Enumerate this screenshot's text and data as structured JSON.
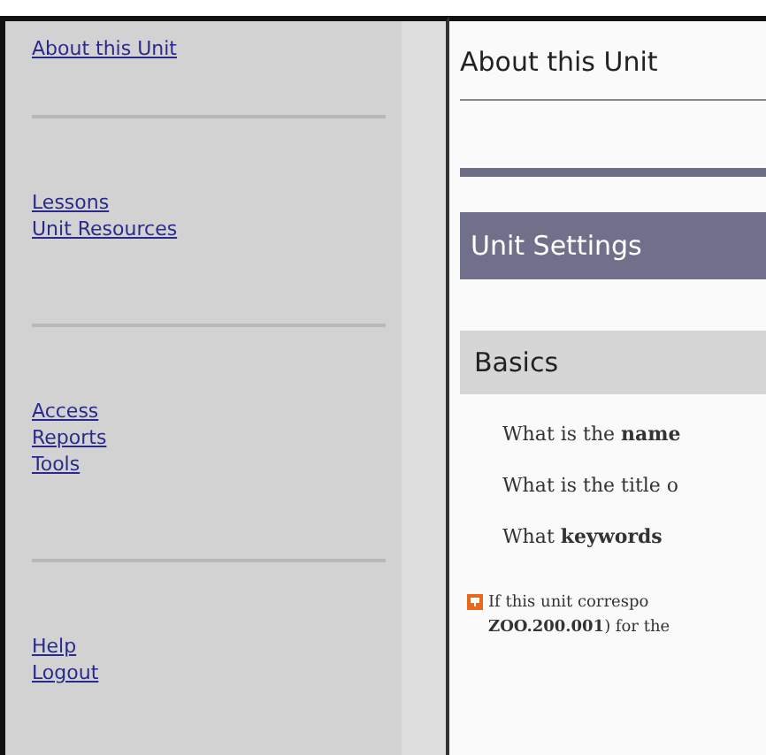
{
  "sidebar": {
    "sections": [
      {
        "links": [
          "About this Unit"
        ]
      },
      {
        "links": [
          "Lessons",
          "Unit Resources"
        ]
      },
      {
        "links": [
          "Access",
          "Reports",
          "Tools"
        ]
      },
      {
        "links": [
          "Help",
          "Logout"
        ]
      }
    ]
  },
  "page_title": "About this Unit",
  "section_header": "Unit Settings",
  "subsection_header": "Basics",
  "questions": [
    "What is the **name**",
    "What is the title o",
    "What **keywords**"
  ],
  "notice": {
    "lines": [
      "If this unit correspo",
      "**ZOO.200.001**) for the"
    ]
  }
}
